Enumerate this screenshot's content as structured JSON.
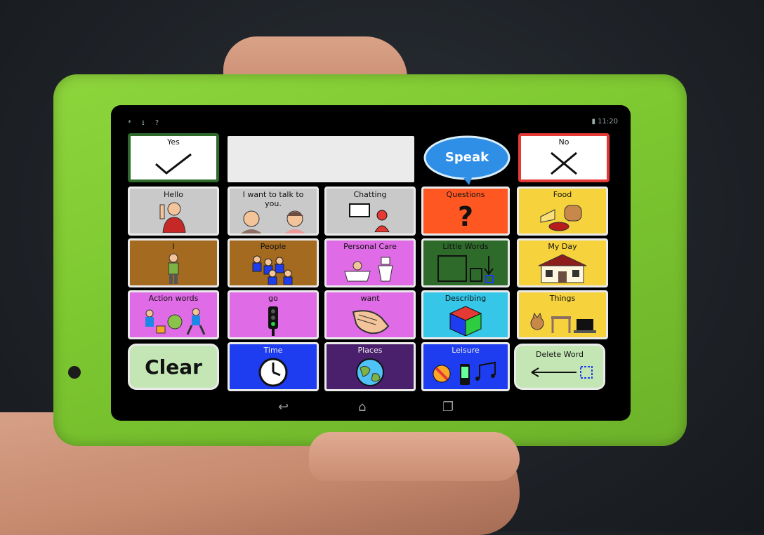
{
  "status_bar": {
    "left_icons": "* ⭳ ?",
    "time": "11:20"
  },
  "message_box": {
    "value": ""
  },
  "speak_label": "Speak",
  "tiles": {
    "yes": "Yes",
    "no": "No",
    "hello": "Hello",
    "talk": "I want to talk to you.",
    "chatting": "Chatting",
    "questions": "Questions",
    "food": "Food",
    "i": "I",
    "people": "People",
    "personal_care": "Personal Care",
    "little_words": "Little Words",
    "my_day": "My Day",
    "action_words": "Action words",
    "go": "go",
    "want": "want",
    "describing": "Describing",
    "things": "Things",
    "clear": "Clear",
    "time": "Time",
    "places": "Places",
    "leisure": "Leisure",
    "delete_word": "Delete Word"
  },
  "colors": {
    "case": "#7cc730",
    "tile_grey": "#c9c9c9",
    "tile_orange": "#ff5722",
    "tile_yellow": "#f6d23c",
    "tile_brown": "#a46a1f",
    "tile_pink": "#e06be6",
    "tile_darkgreen": "#2e6b2a",
    "tile_cyan": "#35c6e8",
    "tile_blue": "#1e3cf0",
    "tile_purple": "#4a1f6b",
    "tile_lightgreen": "#c3e6b4",
    "speak_blue": "#2f8ee6"
  }
}
